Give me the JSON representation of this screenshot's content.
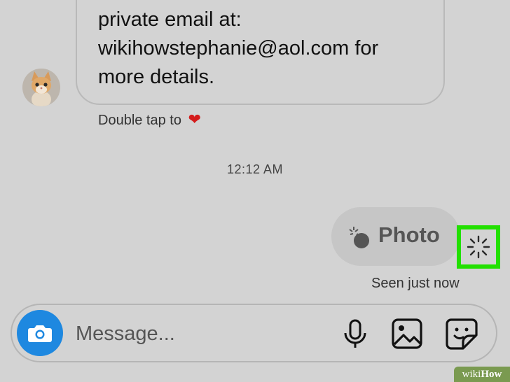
{
  "message": {
    "lines": [
      "private email at:",
      "wikihowstephanie@aol.com for",
      "more details."
    ],
    "reaction_hint": "Double tap to",
    "reaction_emoji": "❤"
  },
  "timestamp": "12:12 AM",
  "sent": {
    "photo_label": "Photo",
    "status": "Seen just now"
  },
  "composer": {
    "placeholder": "Message...",
    "icons": [
      "camera-icon",
      "microphone-icon",
      "gallery-icon",
      "sticker-icon"
    ]
  },
  "watermark": {
    "prefix": "wiki",
    "suffix": "How"
  },
  "colors": {
    "background": "#d3d3d3",
    "camera_button": "#1e88e0",
    "highlight": "#22e000",
    "heart": "#d41c1c"
  }
}
